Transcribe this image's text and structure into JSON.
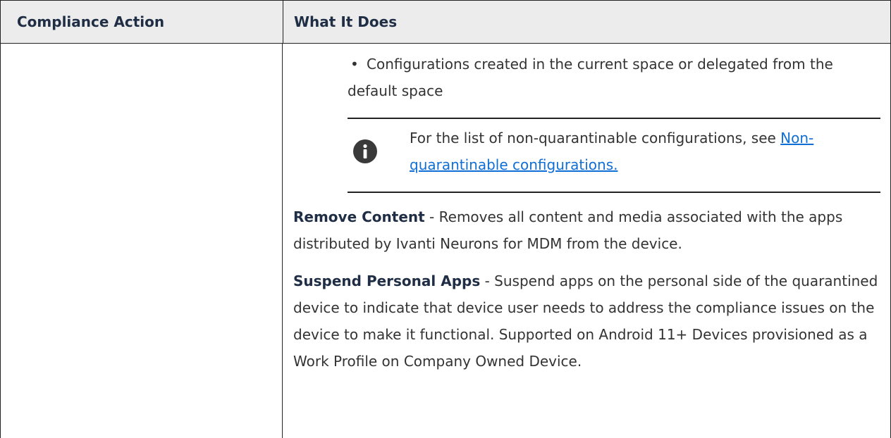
{
  "table": {
    "headers": {
      "col1": "Compliance Action",
      "col2": "What It Does"
    },
    "bullet": "Configurations created in the current space or delegated from the default space",
    "note": {
      "text": "For the list of non-quarantinable configurations, see ",
      "link_text": "Non-quarantinable configurations."
    },
    "remove_content": {
      "term": "Remove Content",
      "description": " - Removes all content and media associated with the apps distributed by Ivanti Neurons for MDM from the device."
    },
    "suspend_apps": {
      "term": "Suspend Personal Apps",
      "description": " - Suspend apps on the personal side of the quarantined device to indicate that device user needs to address the compliance issues on the device to make it functional. Supported on Android 11+ Devices provisioned as a Work Profile on Company Owned Device."
    }
  },
  "colors": {
    "header_bg": "#ececec",
    "border": "#222222",
    "link": "#0f6fd6",
    "text": "#333333",
    "heading_text": "#1f2e44"
  },
  "icons": {
    "note": "info-icon"
  }
}
